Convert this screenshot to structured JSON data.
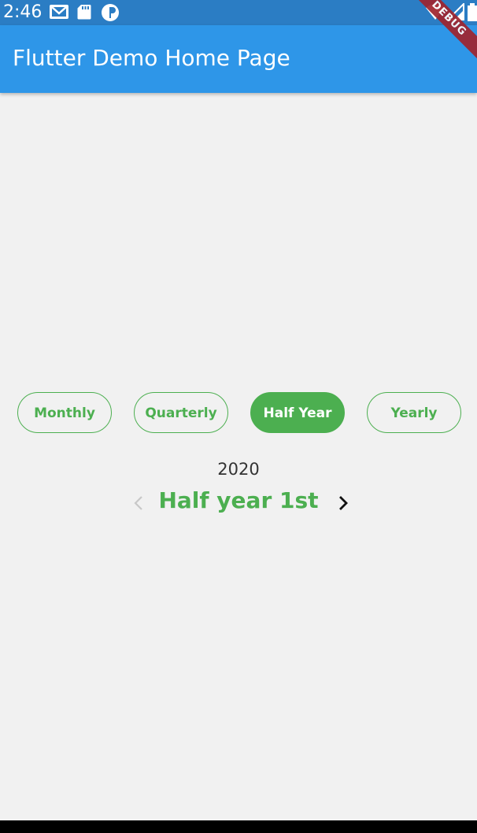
{
  "status_bar": {
    "time": "2:46",
    "icons": [
      "gmail-icon",
      "sd-card-icon",
      "circle-notification-icon",
      "wifi-icon",
      "signal-icon",
      "battery-icon"
    ]
  },
  "app_bar": {
    "title": "Flutter Demo Home Page",
    "debug_banner": "DEBUG"
  },
  "filters": {
    "options": [
      "Monthly",
      "Quarterly",
      "Half Year",
      "Yearly"
    ],
    "selected": "Half Year"
  },
  "period": {
    "year": "2020",
    "label": "Half year 1st",
    "prev_enabled": false,
    "next_enabled": true
  },
  "colors": {
    "status_bar": "#2b7dc4",
    "app_bar": "#2e96e8",
    "accent_green": "#4caf50",
    "background": "#f1f1f1"
  }
}
